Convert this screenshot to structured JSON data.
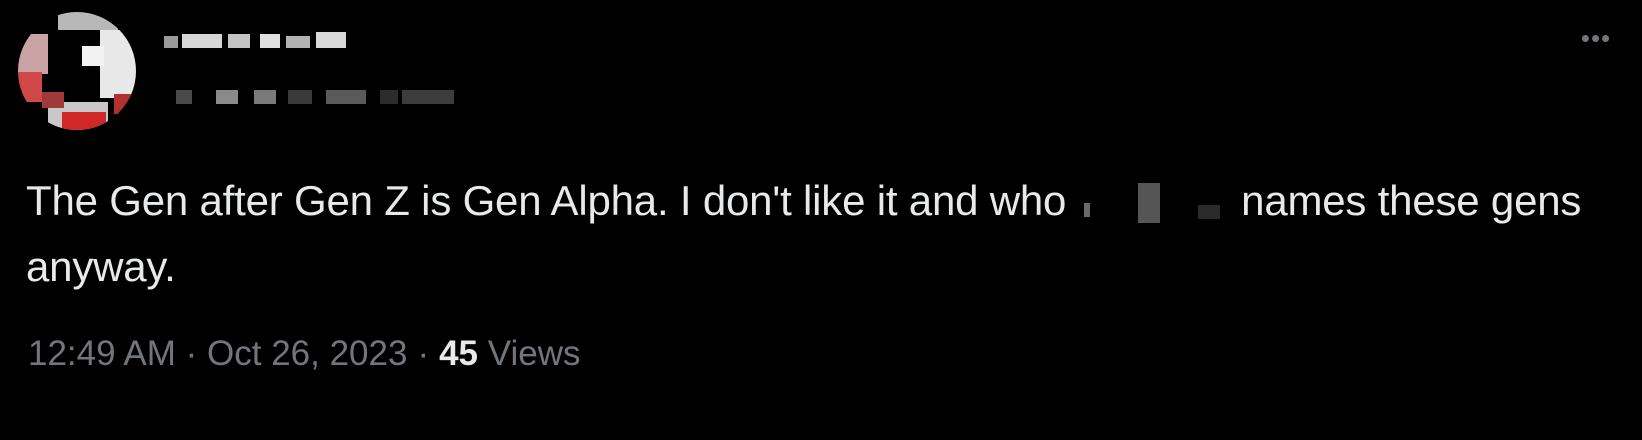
{
  "tweet": {
    "text_part1": "The Gen after Gen Z is Gen Alpha. I don't like it and who",
    "text_part2": "names these gens anyway.",
    "time": "12:49 AM",
    "separator1": "·",
    "date": "Oct 26, 2023",
    "separator2": "·",
    "views_count": "45",
    "views_label": "Views"
  },
  "icons": {
    "more": "more-horizontal-icon"
  },
  "colors": {
    "background": "#000000",
    "text_primary": "#e7e9ea",
    "text_secondary": "#71767b"
  }
}
